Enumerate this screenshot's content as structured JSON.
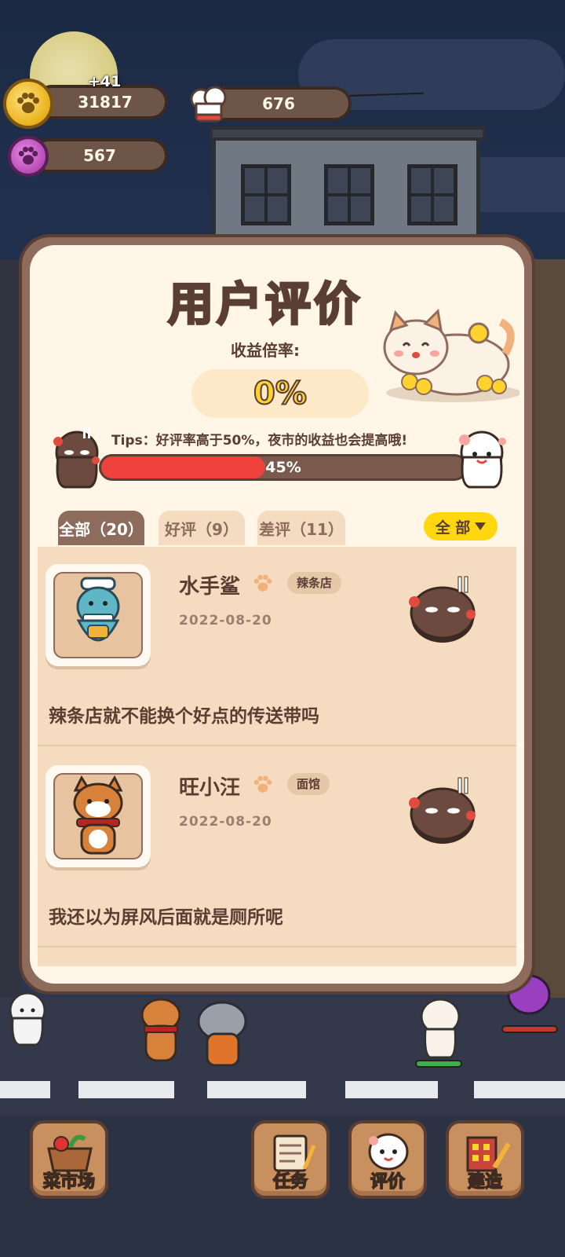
{
  "resources": {
    "coins": "31817",
    "coins_gain": "+41",
    "chef_hats": "676",
    "paw_gems": "567"
  },
  "panel": {
    "title": "用户评价",
    "subtitle": "收益倍率:",
    "rate": "0%",
    "tips": "Tips：好评率高于50%，夜市的收益也会提高哦!",
    "progress_label": "45%",
    "progress_value": 0.45
  },
  "tabs": [
    {
      "label": "全部（20）",
      "active": true
    },
    {
      "label": "好评（9）",
      "active": false
    },
    {
      "label": "差评（11）",
      "active": false
    }
  ],
  "filter": {
    "label": "全 部",
    "icon": "caret-down-icon"
  },
  "reviews": [
    {
      "name": "水手鲨",
      "shop": "辣条店",
      "date": "2022-08-20",
      "comment": "辣条店就不能换个好点的传送带吗",
      "mood": "angry-face-icon",
      "avatar": "shark-sailor"
    },
    {
      "name": "旺小汪",
      "shop": "面馆",
      "date": "2022-08-20",
      "comment": "我还以为屏风后面就是厕所呢",
      "mood": "angry-face-icon",
      "avatar": "shiba-dog"
    }
  ],
  "bottom_nav": [
    {
      "label": "菜市场",
      "icon": "market-basket-icon"
    },
    {
      "label": "任务",
      "icon": "task-scroll-icon"
    },
    {
      "label": "评价",
      "icon": "ghost-face-icon"
    },
    {
      "label": "建造",
      "icon": "build-brush-icon"
    }
  ],
  "colors": {
    "accent_yellow": "#ffd22e",
    "panel_brown": "#8d6b5d",
    "progress_red": "#f0423c",
    "cream": "#fff6e8"
  }
}
